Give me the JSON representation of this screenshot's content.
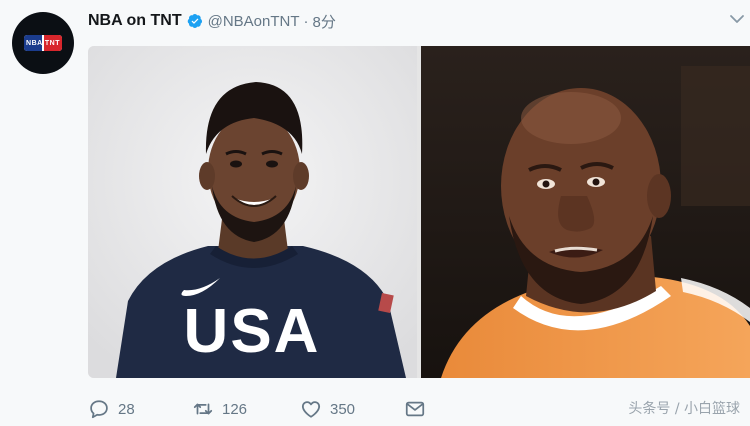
{
  "tweet": {
    "name": "NBA on TNT",
    "handle": "@NBAonTNT",
    "separator": "·",
    "time": "8分",
    "avatar_logo_text": "NBA TNT",
    "media": [
      {
        "jersey_text": "USA"
      },
      {}
    ],
    "actions": {
      "reply_count": "28",
      "retweet_count": "126",
      "like_count": "350"
    }
  },
  "watermark": "头条号 / 小白篮球",
  "colors": {
    "verified": "#1da1f2",
    "icon_gray": "#657786",
    "usa_navy": "#1f2a44",
    "suns_orange": "#f29a43"
  }
}
